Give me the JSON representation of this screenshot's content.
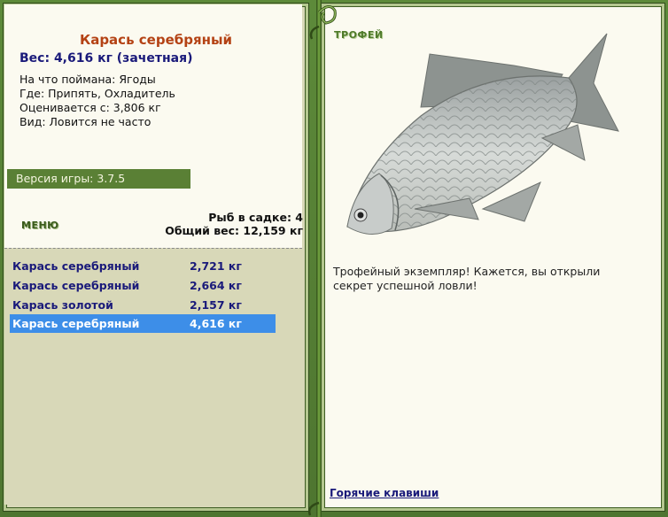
{
  "fish": {
    "name": "Карась серебряный",
    "weight_line": "Вес: 4,616 кг (зачетная)",
    "caught_on": "На что поймана: Ягоды",
    "where": "Где: Припять, Охладитель",
    "rated_from": "Оценивается с: 3,806 кг",
    "kind": "Вид: Ловится не часто"
  },
  "version": "Версия игры: 3.7.5",
  "menu_label": "МЕНЮ",
  "keep": {
    "count": "Рыб в садке: 4",
    "total": "Общий вес: 12,159 кг"
  },
  "catch_list": [
    {
      "name": "Карась серебряный",
      "weight": "2,721 кг"
    },
    {
      "name": "Карась серебряный",
      "weight": "2,664 кг"
    },
    {
      "name": "Карась золотой",
      "weight": "2,157 кг"
    },
    {
      "name": "Карась серебряный",
      "weight": "4,616 кг"
    }
  ],
  "selected_index": 3,
  "trophy": {
    "label": "ТРОФЕЙ",
    "text": "Трофейный экземпляр! Кажется, вы открыли секрет успешной ловли!"
  },
  "hotkeys_label": "Горячие клавиши",
  "colors": {
    "frame": "#577d36",
    "panel_bg": "#fbfaf0",
    "list_bg": "#d8d8b8",
    "selected_row": "#3d8ee8",
    "fish_name": "#b44214",
    "link": "#1a1a7a"
  },
  "icons": {
    "fish_image": "crucian-carp-image",
    "vine": "vine-decoration"
  }
}
